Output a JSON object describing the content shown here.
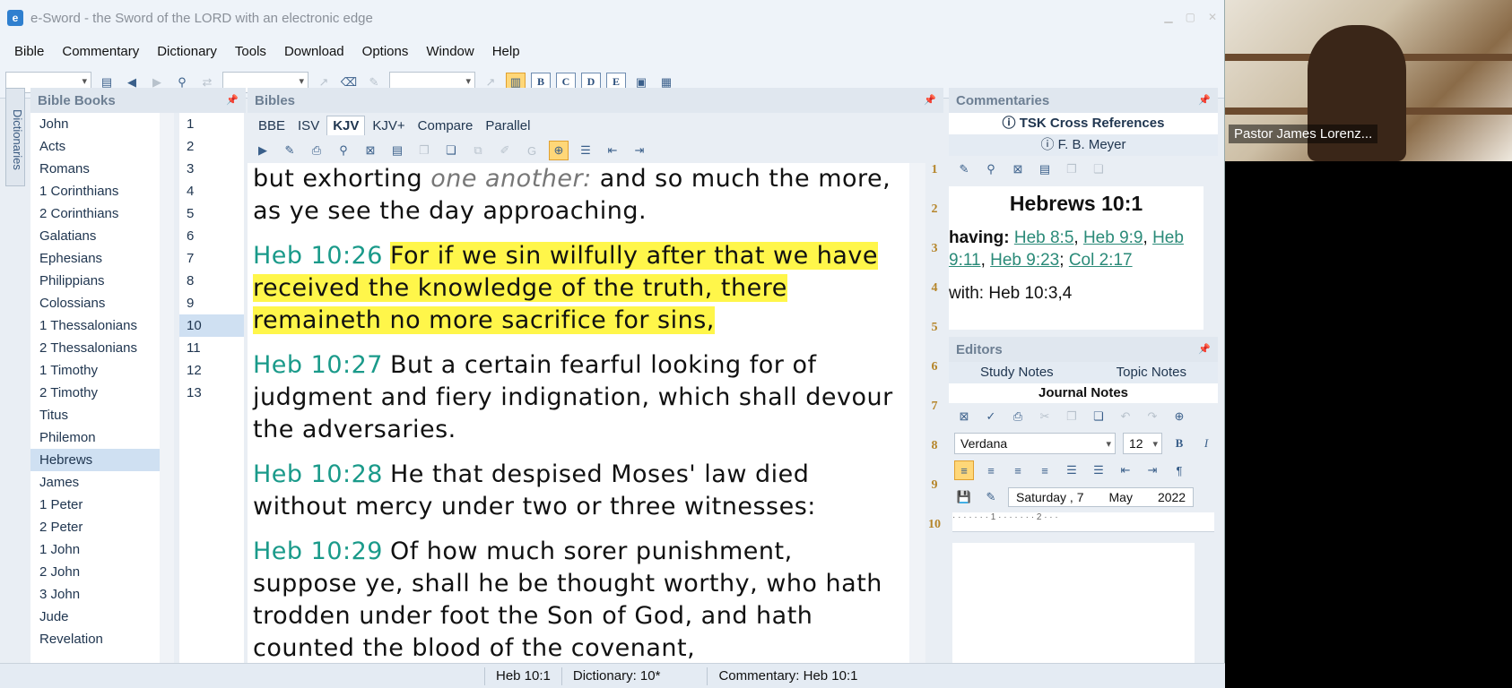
{
  "window": {
    "title": "e-Sword - the Sword of the LORD with an electronic edge"
  },
  "menu": [
    "Bible",
    "Commentary",
    "Dictionary",
    "Tools",
    "Download",
    "Options",
    "Window",
    "Help"
  ],
  "toolbar": {
    "mode_letters": [
      "B",
      "C",
      "D",
      "E"
    ]
  },
  "sidebar": {
    "dictionaries_tab": "Dictionaries"
  },
  "books_panel": {
    "title": "Bible Books",
    "books": [
      "John",
      "Acts",
      "Romans",
      "1 Corinthians",
      "2 Corinthians",
      "Galatians",
      "Ephesians",
      "Philippians",
      "Colossians",
      "1 Thessalonians",
      "2 Thessalonians",
      "1 Timothy",
      "2 Timothy",
      "Titus",
      "Philemon",
      "Hebrews",
      "James",
      "1 Peter",
      "2 Peter",
      "1 John",
      "2 John",
      "3 John",
      "Jude",
      "Revelation"
    ],
    "selected_book": "Hebrews",
    "chapters": [
      "1",
      "2",
      "3",
      "4",
      "5",
      "6",
      "7",
      "8",
      "9",
      "10",
      "11",
      "12",
      "13"
    ],
    "selected_chapter": "10"
  },
  "bibles_panel": {
    "title": "Bibles",
    "tabs": [
      "BBE",
      "ISV",
      "KJV",
      "KJV+",
      "Compare",
      "Parallel"
    ],
    "active_tab": "KJV",
    "text_top": {
      "pre": "but exhorting ",
      "italic": "one another:",
      "post": " and so much the more, as ye see the day approaching."
    },
    "verses": [
      {
        "ref": "Heb 10:26",
        "text": "For if we sin wilfully after that we have received the knowledge of the truth, there remaineth no more sacrifice for sins,",
        "highlight": true
      },
      {
        "ref": "Heb 10:27",
        "text": "But a certain fearful looking for of judgment and fiery indignation, which shall devour the adversaries.",
        "highlight": false
      },
      {
        "ref": "Heb 10:28",
        "text": "He that despised Moses' law died without mercy under two or three witnesses:",
        "highlight": false
      },
      {
        "ref": "Heb 10:29",
        "text": "Of how much sorer punishment, suppose ye, shall he be thought worthy, who hath trodden under foot the Son of God, and hath counted the blood of the covenant,",
        "highlight": false
      }
    ],
    "chapter_rail": [
      "1",
      "2",
      "3",
      "4",
      "5",
      "6",
      "7",
      "8",
      "9",
      "10"
    ]
  },
  "commentaries": {
    "title": "Commentaries",
    "tab_active": "TSK Cross References",
    "tab_other": "F. B. Meyer",
    "heading": "Hebrews 10:1",
    "label_having": "having:",
    "links": [
      "Heb 8:5",
      "Heb 9:9",
      "Heb 9:11",
      "Heb 9:23",
      "Col 2:17"
    ],
    "cut_line": "with: Heb 10:3,4"
  },
  "editors": {
    "title": "Editors",
    "tabs": [
      "Study Notes",
      "Topic Notes"
    ],
    "active_tab": "Journal Notes",
    "font": "Verdana",
    "size": "12",
    "date": {
      "day": "Saturday , 7",
      "month": "May",
      "year": "2022"
    }
  },
  "statusbar": {
    "verse": "Heb 10:1",
    "dictionary": "Dictionary: 10*",
    "commentary": "Commentary: Heb 10:1"
  },
  "video": {
    "speaker": "Pastor James Lorenz..."
  }
}
